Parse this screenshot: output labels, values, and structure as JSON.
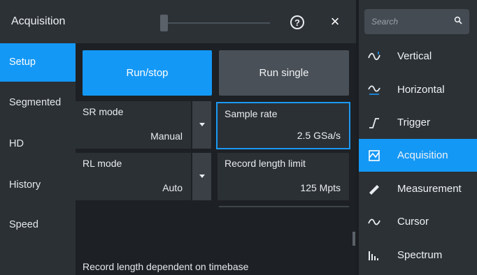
{
  "dialog": {
    "title": "Acquisition",
    "help_label": "?",
    "close_label": "×"
  },
  "tabs": [
    {
      "label": "Setup",
      "active": true
    },
    {
      "label": "Segmented",
      "active": false
    },
    {
      "label": "HD",
      "active": false
    },
    {
      "label": "History",
      "active": false
    },
    {
      "label": "Speed",
      "active": false
    }
  ],
  "setup": {
    "run_stop_label": "Run/stop",
    "run_single_label": "Run single",
    "sr_mode": {
      "label": "SR mode",
      "value": "Manual"
    },
    "sample_rate": {
      "label": "Sample rate",
      "value": "2.5 GSa/s"
    },
    "rl_mode": {
      "label": "RL mode",
      "value": "Auto"
    },
    "record_length_limit": {
      "label": "Record length limit",
      "value": "125 Mpts"
    },
    "info_text": "Record length dependent on timebase"
  },
  "menu": {
    "search_placeholder": "Search",
    "items": [
      {
        "label": "Vertical",
        "icon": "vertical-icon",
        "active": false
      },
      {
        "label": "Horizontal",
        "icon": "horizontal-icon",
        "active": false
      },
      {
        "label": "Trigger",
        "icon": "trigger-icon",
        "active": false
      },
      {
        "label": "Acquisition",
        "icon": "acquisition-icon",
        "active": true
      },
      {
        "label": "Measurement",
        "icon": "measurement-icon",
        "active": false
      },
      {
        "label": "Cursor",
        "icon": "cursor-icon",
        "active": false
      },
      {
        "label": "Spectrum",
        "icon": "spectrum-icon",
        "active": false
      }
    ]
  },
  "colors": {
    "accent": "#1498f6",
    "panel": "#2b3035",
    "background": "#1b1e22"
  }
}
